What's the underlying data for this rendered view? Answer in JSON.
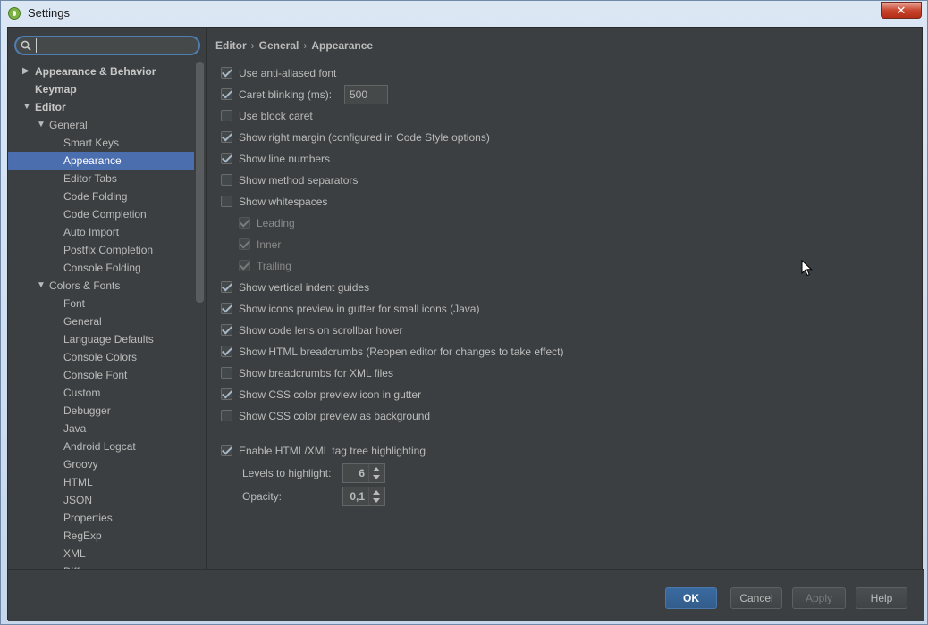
{
  "window": {
    "title": "Settings",
    "close_label": "✕"
  },
  "search": {
    "value": "",
    "placeholder": ""
  },
  "tree": [
    {
      "label": "Appearance & Behavior",
      "indent": 0,
      "arrow": "right",
      "bold": true
    },
    {
      "label": "Keymap",
      "indent": 0,
      "arrow": "",
      "bold": true
    },
    {
      "label": "Editor",
      "indent": 0,
      "arrow": "down",
      "bold": true
    },
    {
      "label": "General",
      "indent": 1,
      "arrow": "down",
      "bold": false
    },
    {
      "label": "Smart Keys",
      "indent": 2,
      "arrow": "",
      "bold": false
    },
    {
      "label": "Appearance",
      "indent": 2,
      "arrow": "",
      "bold": false,
      "selected": true
    },
    {
      "label": "Editor Tabs",
      "indent": 2,
      "arrow": "",
      "bold": false
    },
    {
      "label": "Code Folding",
      "indent": 2,
      "arrow": "",
      "bold": false
    },
    {
      "label": "Code Completion",
      "indent": 2,
      "arrow": "",
      "bold": false
    },
    {
      "label": "Auto Import",
      "indent": 2,
      "arrow": "",
      "bold": false
    },
    {
      "label": "Postfix Completion",
      "indent": 2,
      "arrow": "",
      "bold": false
    },
    {
      "label": "Console Folding",
      "indent": 2,
      "arrow": "",
      "bold": false
    },
    {
      "label": "Colors & Fonts",
      "indent": 1,
      "arrow": "down",
      "bold": false
    },
    {
      "label": "Font",
      "indent": 2,
      "arrow": "",
      "bold": false
    },
    {
      "label": "General",
      "indent": 2,
      "arrow": "",
      "bold": false
    },
    {
      "label": "Language Defaults",
      "indent": 2,
      "arrow": "",
      "bold": false
    },
    {
      "label": "Console Colors",
      "indent": 2,
      "arrow": "",
      "bold": false
    },
    {
      "label": "Console Font",
      "indent": 2,
      "arrow": "",
      "bold": false
    },
    {
      "label": "Custom",
      "indent": 2,
      "arrow": "",
      "bold": false
    },
    {
      "label": "Debugger",
      "indent": 2,
      "arrow": "",
      "bold": false
    },
    {
      "label": "Java",
      "indent": 2,
      "arrow": "",
      "bold": false
    },
    {
      "label": "Android Logcat",
      "indent": 2,
      "arrow": "",
      "bold": false
    },
    {
      "label": "Groovy",
      "indent": 2,
      "arrow": "",
      "bold": false
    },
    {
      "label": "HTML",
      "indent": 2,
      "arrow": "",
      "bold": false
    },
    {
      "label": "JSON",
      "indent": 2,
      "arrow": "",
      "bold": false
    },
    {
      "label": "Properties",
      "indent": 2,
      "arrow": "",
      "bold": false
    },
    {
      "label": "RegExp",
      "indent": 2,
      "arrow": "",
      "bold": false
    },
    {
      "label": "XML",
      "indent": 2,
      "arrow": "",
      "bold": false
    },
    {
      "label": "Diff",
      "indent": 2,
      "arrow": "",
      "bold": false
    }
  ],
  "breadcrumb": [
    "Editor",
    "General",
    "Appearance"
  ],
  "breadcrumb_sep": "›",
  "options": [
    {
      "label": "Use anti-aliased font",
      "checked": true
    },
    {
      "label": "Caret blinking (ms):",
      "checked": true
    },
    {
      "label": "Use block caret",
      "checked": false
    },
    {
      "label": "Show right margin (configured in Code Style options)",
      "checked": true
    },
    {
      "label": "Show line numbers",
      "checked": true
    },
    {
      "label": "Show method separators",
      "checked": false
    },
    {
      "label": "Show whitespaces",
      "checked": false
    },
    {
      "label": "Leading",
      "checked": true,
      "disabled": true,
      "sub": true
    },
    {
      "label": "Inner",
      "checked": true,
      "disabled": true,
      "sub": true
    },
    {
      "label": "Trailing",
      "checked": true,
      "disabled": true,
      "sub": true
    },
    {
      "label": "Show vertical indent guides",
      "checked": true
    },
    {
      "label": "Show icons preview in gutter for small icons (Java)",
      "checked": true
    },
    {
      "label": "Show code lens on scrollbar hover",
      "checked": true
    },
    {
      "label": "Show HTML breadcrumbs (Reopen editor for changes to take effect)",
      "checked": true
    },
    {
      "label": "Show breadcrumbs for XML files",
      "checked": false
    },
    {
      "label": "Show CSS color preview icon in gutter",
      "checked": true
    },
    {
      "label": "Show CSS color preview as background",
      "checked": false
    }
  ],
  "caret_blink_value": "500",
  "tag_tree": {
    "label": "Enable HTML/XML tag tree highlighting",
    "checked": true
  },
  "levels": {
    "label": "Levels to highlight:",
    "value": "6"
  },
  "opacity": {
    "label": "Opacity:",
    "value": "0,1"
  },
  "buttons": {
    "ok": "OK",
    "cancel": "Cancel",
    "apply": "Apply",
    "help": "Help"
  }
}
